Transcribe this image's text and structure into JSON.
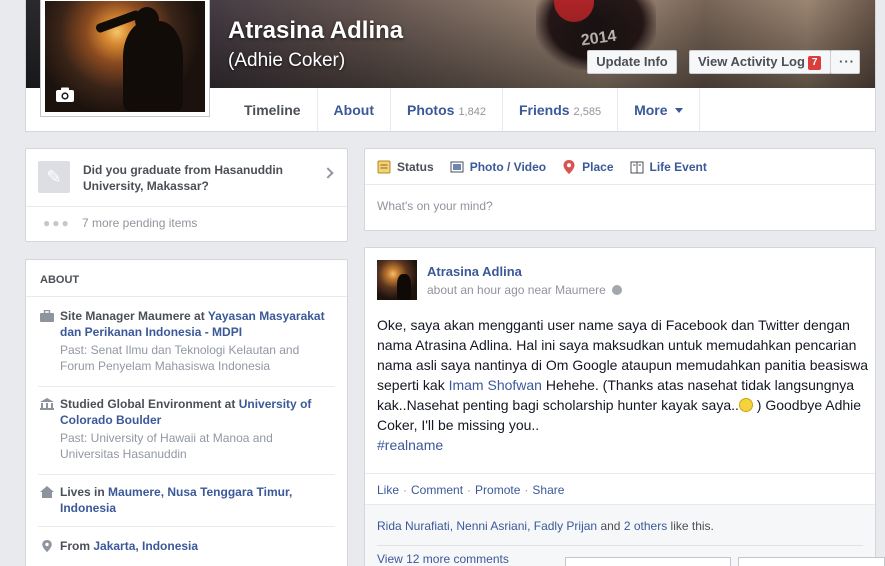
{
  "profile": {
    "name": "Atrasina Adlina",
    "alt_name": "(Adhie Coker)",
    "cover_text": "2014",
    "buttons": {
      "update_info": "Update Info",
      "activity_log": "View Activity Log",
      "activity_badge": "7",
      "more": "···"
    },
    "tabs": [
      {
        "label": "Timeline",
        "count": ""
      },
      {
        "label": "About",
        "count": ""
      },
      {
        "label": "Photos",
        "count": "1,842"
      },
      {
        "label": "Friends",
        "count": "2,585"
      },
      {
        "label": "More",
        "count": ""
      }
    ]
  },
  "pending": {
    "question": "Did you graduate from Hasanuddin University, Makassar?",
    "more_items": "7 more pending items"
  },
  "about": {
    "heading": "ABOUT",
    "work": {
      "title_prefix": "Site Manager Maumere at",
      "org": "Yayasan Masyarakat dan Perikanan Indonesia - MDPI",
      "past": "Past: Senat Ilmu dan Teknologi Kelautan and Forum Penyelam Mahasiswa Indonesia"
    },
    "education": {
      "title_prefix": "Studied Global Environment at",
      "org": "University of Colorado Boulder",
      "past": "Past: University of Hawaii at Manoa and Universitas Hasanuddin"
    },
    "lives": {
      "prefix": "Lives in",
      "place": "Maumere, Nusa Tenggara Timur, Indonesia"
    },
    "from": {
      "prefix": "From",
      "place": "Jakarta, Indonesia"
    }
  },
  "composer": {
    "tabs": [
      {
        "label": "Status",
        "icon": "status-icon"
      },
      {
        "label": "Photo / Video",
        "icon": "photo-icon"
      },
      {
        "label": "Place",
        "icon": "place-icon"
      },
      {
        "label": "Life Event",
        "icon": "life-event-icon"
      }
    ],
    "placeholder": "What's on your mind?"
  },
  "post": {
    "author": "Atrasina Adlina",
    "time": "about an hour ago",
    "location_prefix": "near",
    "location": "Maumere",
    "body_part1": "Oke, saya akan mengganti user name saya di Facebook dan Twitter dengan nama Atrasina Adlina. Hal ini saya maksudkan untuk memudahkan pencarian nama asli saya nantinya di Om Google ataupun memudahkan panitia beasiswa seperti kak",
    "body_mention": "Imam Shofwan",
    "body_part2": "Hehehe. (Thanks atas nasehat tidak langsungnya kak..Nasehat penting bagi scholarship hunter kayak saya..",
    "body_part3": ") Goodbye Adhie Coker, I'll be missing you..",
    "hashtag": "#realname",
    "actions": [
      "Like",
      "Comment",
      "Promote",
      "Share"
    ],
    "likes_names": "Rida Nurafiati, Nenni Asriani, Fadly Prijan",
    "likes_others": "2 others",
    "likes_and": "and",
    "likes_suffix": "like this.",
    "view_comments": "View 12 more comments"
  },
  "colors": {
    "link": "#3b5998",
    "badge": "#d93e3e",
    "background": "#e9eaed"
  }
}
